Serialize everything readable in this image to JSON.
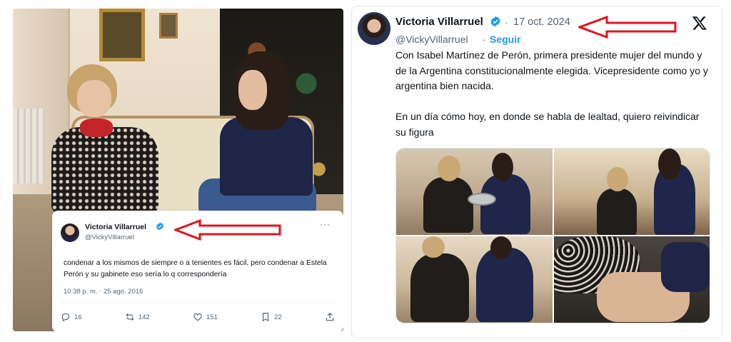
{
  "left_tweet": {
    "author_name": "Victoria Villarruel",
    "author_handle": "@VickyVillarruel",
    "more_label": "···",
    "text": "condenar a los mismos de siempre o a tenientes es fácil, pero condenar a Estela Perón y su gabinete eso sería lo q correspondería",
    "timestamp": "10:38 p. m. · 25 ago. 2016",
    "stats": {
      "replies": "16",
      "reposts": "142",
      "likes": "151",
      "bookmarks": "22"
    }
  },
  "right_tweet": {
    "author_name": "Victoria Villarruel",
    "separator": "·",
    "date": "17 oct. 2024",
    "author_handle": "@VickyVillarruel",
    "dot": "·",
    "follow_label": "Seguir",
    "text_paragraph_1": "Con Isabel Martínez de Perón, primera presidente mujer del mundo y de la Argentina constitucionalmente elegida. Vicepresidente como yo y argentina bien nacida.",
    "text_paragraph_2": "En un día cómo hoy, en donde se habla de lealtad, quiero reivindicar su figura"
  },
  "icons": {
    "verified": "verified-badge-icon",
    "x_logo": "x-logo-icon",
    "reply": "reply-icon",
    "repost": "repost-icon",
    "like": "heart-icon",
    "bookmark": "bookmark-icon",
    "share": "share-icon"
  },
  "colors": {
    "arrow_red": "#e0141e",
    "verified_blue": "#1d9bf0",
    "follow_blue": "#1d9bf0",
    "muted_text": "#536471"
  }
}
